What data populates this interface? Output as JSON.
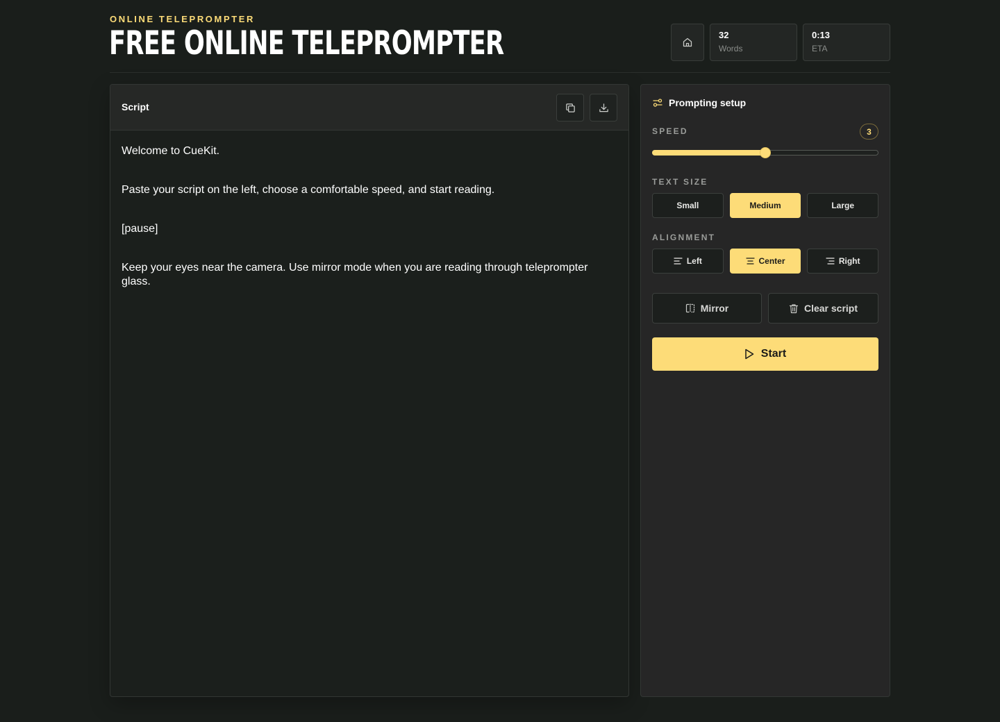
{
  "header": {
    "eyebrow": "ONLINE TELEPROMPTER",
    "title": "FREE ONLINE TELEPROMPTER",
    "home_icon": "home-icon",
    "stats": {
      "words_value": "32",
      "words_label": "Words",
      "eta_value": "0:13",
      "eta_label": "ETA"
    }
  },
  "script": {
    "title": "Script",
    "copy_icon": "copy-icon",
    "download_icon": "download-icon",
    "lines": [
      "Welcome to CueKit.",
      "Paste your script on the left, choose a comfortable speed, and start reading.",
      "[pause]",
      "Keep your eyes near the camera. Use mirror mode when you are reading through teleprompter glass."
    ]
  },
  "setup": {
    "title": "Prompting setup",
    "title_icon": "sliders-icon",
    "speed": {
      "label": "SPEED",
      "value": "3",
      "slider_fraction": 0.5
    },
    "text_size": {
      "label": "TEXT SIZE",
      "options": [
        "Small",
        "Medium",
        "Large"
      ],
      "selected": "Medium"
    },
    "alignment": {
      "label": "ALIGNMENT",
      "options": [
        "Left",
        "Center",
        "Right"
      ],
      "selected": "Center"
    },
    "mirror_label": "Mirror",
    "clear_label": "Clear script",
    "start_label": "Start"
  },
  "colors": {
    "accent": "#fddc78",
    "background": "#1a1e1b",
    "panel": "#262626"
  }
}
